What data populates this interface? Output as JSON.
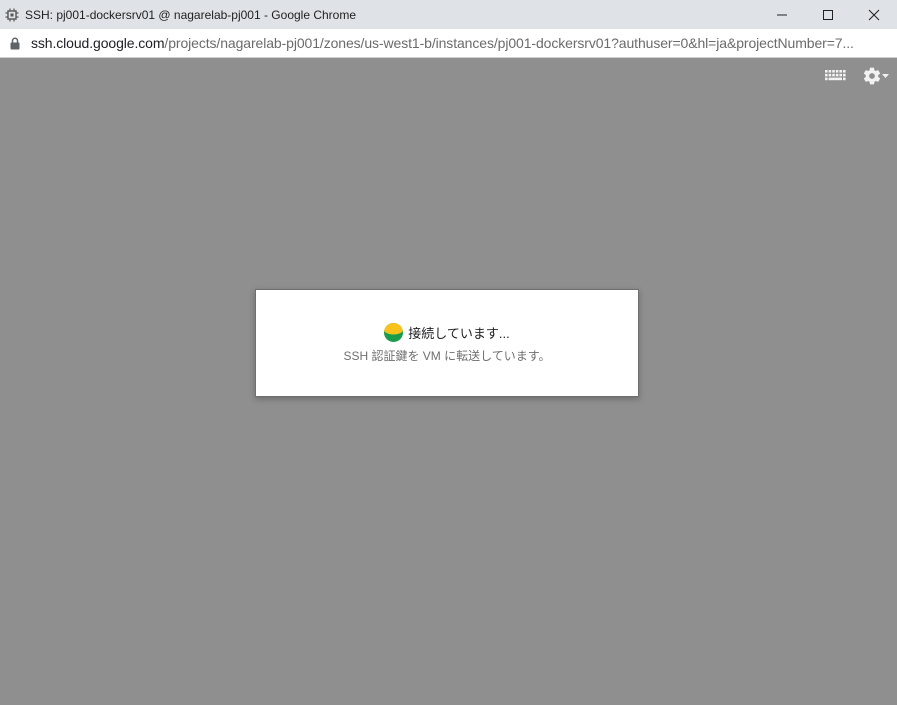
{
  "window": {
    "title": "SSH: pj001-dockersrv01 @ nagarelab-pj001 - Google Chrome",
    "app_icon": "chip-icon",
    "controls": [
      "minimize-icon",
      "maximize-icon",
      "close-icon"
    ]
  },
  "address_bar": {
    "icon": "lock-icon",
    "url_host": "ssh.cloud.google.com",
    "url_path": "/projects/nagarelab-pj001/zones/us-west1-b/instances/pj001-dockersrv01?authuser=0&hl=ja&projectNumber=7..."
  },
  "toolbar": {
    "keyboard_icon": "keyboard-icon",
    "settings_icon": "gear-icon"
  },
  "dialog": {
    "spinner_icon": "spinner-icon",
    "title": "接続しています...",
    "subtitle": "SSH 認証鍵を VM に転送しています。"
  },
  "colors": {
    "background": "#8f8f8f",
    "titlebar": "#dfe3e8",
    "spinner_yellow": "#f9c21b",
    "spinner_green": "#1a9c4a"
  }
}
